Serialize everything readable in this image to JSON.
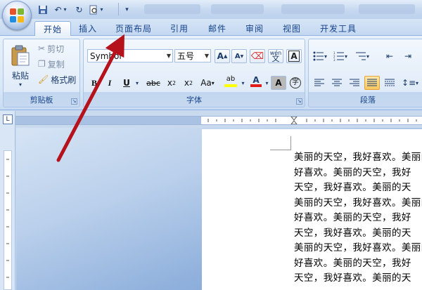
{
  "tabs": [
    {
      "label": "开始",
      "active": true
    },
    {
      "label": "插入"
    },
    {
      "label": "页面布局"
    },
    {
      "label": "引用"
    },
    {
      "label": "邮件"
    },
    {
      "label": "审阅"
    },
    {
      "label": "视图"
    },
    {
      "label": "开发工具"
    }
  ],
  "clipboard": {
    "paste_label": "粘贴",
    "cut_label": "剪切",
    "copy_label": "复制",
    "format_painter_label": "格式刷",
    "group_label": "剪贴板"
  },
  "font": {
    "font_name": "Symbol",
    "font_size": "五号",
    "group_label": "字体",
    "grow_label": "A",
    "shrink_label": "A",
    "bold_label": "B",
    "italic_label": "I",
    "underline_label": "U",
    "strike_label": "abc",
    "subscript_label": "x",
    "superscript_label": "x",
    "change_case_label": "Aa",
    "highlight_label": "ab",
    "font_color_label": "A",
    "char_shading_label": "A",
    "phonetic_label": "wén",
    "char_border_label": "A",
    "enclose_label": "字"
  },
  "paragraph": {
    "group_label": "段落"
  },
  "document": {
    "lines": [
      "美丽的天空，我好喜欢。美丽的天",
      "好喜欢。美丽的天空，我好",
      "天空，我好喜欢。美丽的天",
      "美丽的天空，我好喜欢。美丽的天",
      "好喜欢。美丽的天空，我好",
      "天空，我好喜欢。美丽的天",
      "美丽的天空，我好喜欢。美丽的天",
      "好喜欢。美丽的天空，我好",
      "天空，我好喜欢。美丽的天"
    ]
  },
  "colors": {
    "accent": "#15428b",
    "arrow": "#b5121b",
    "highlight": "#f8c75f"
  }
}
